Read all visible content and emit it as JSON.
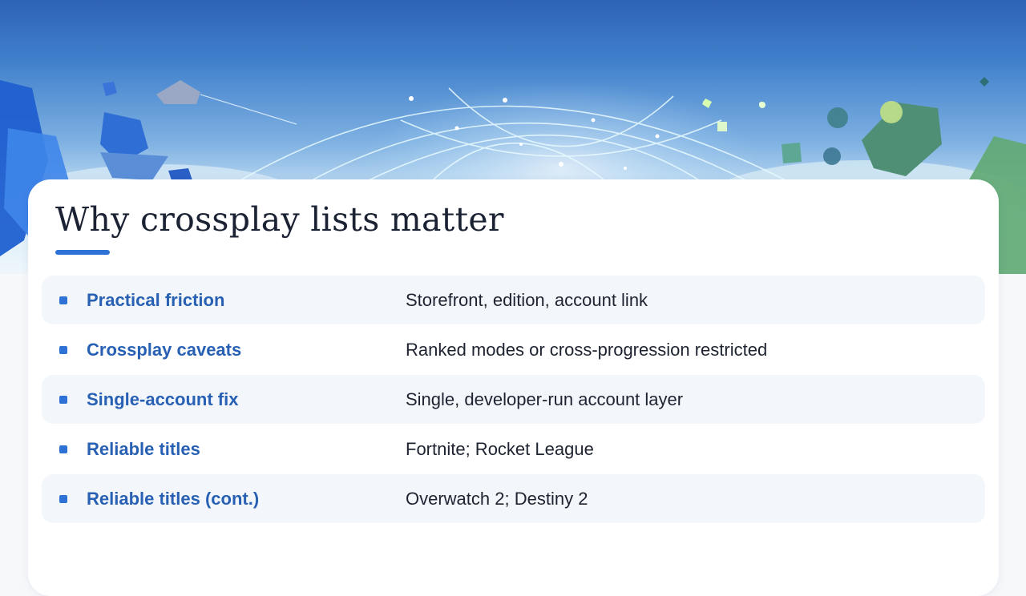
{
  "slide": {
    "title": "Why crossplay lists matter",
    "accent_color": "#2f72d6",
    "label_color": "#2860b3",
    "banner_image": "stylized sky scene with floating islands, a spaceship and a glowing network globe"
  },
  "rows": [
    {
      "label": "Practical friction",
      "value": "Storefront, edition, account link"
    },
    {
      "label": "Crossplay caveats",
      "value": "Ranked modes or cross-progression restricted"
    },
    {
      "label": "Single-account fix",
      "value": "Single, developer-run account layer"
    },
    {
      "label": "Reliable titles",
      "value": "Fortnite; Rocket League"
    },
    {
      "label": "Reliable titles (cont.)",
      "value": "Overwatch 2; Destiny 2"
    }
  ]
}
